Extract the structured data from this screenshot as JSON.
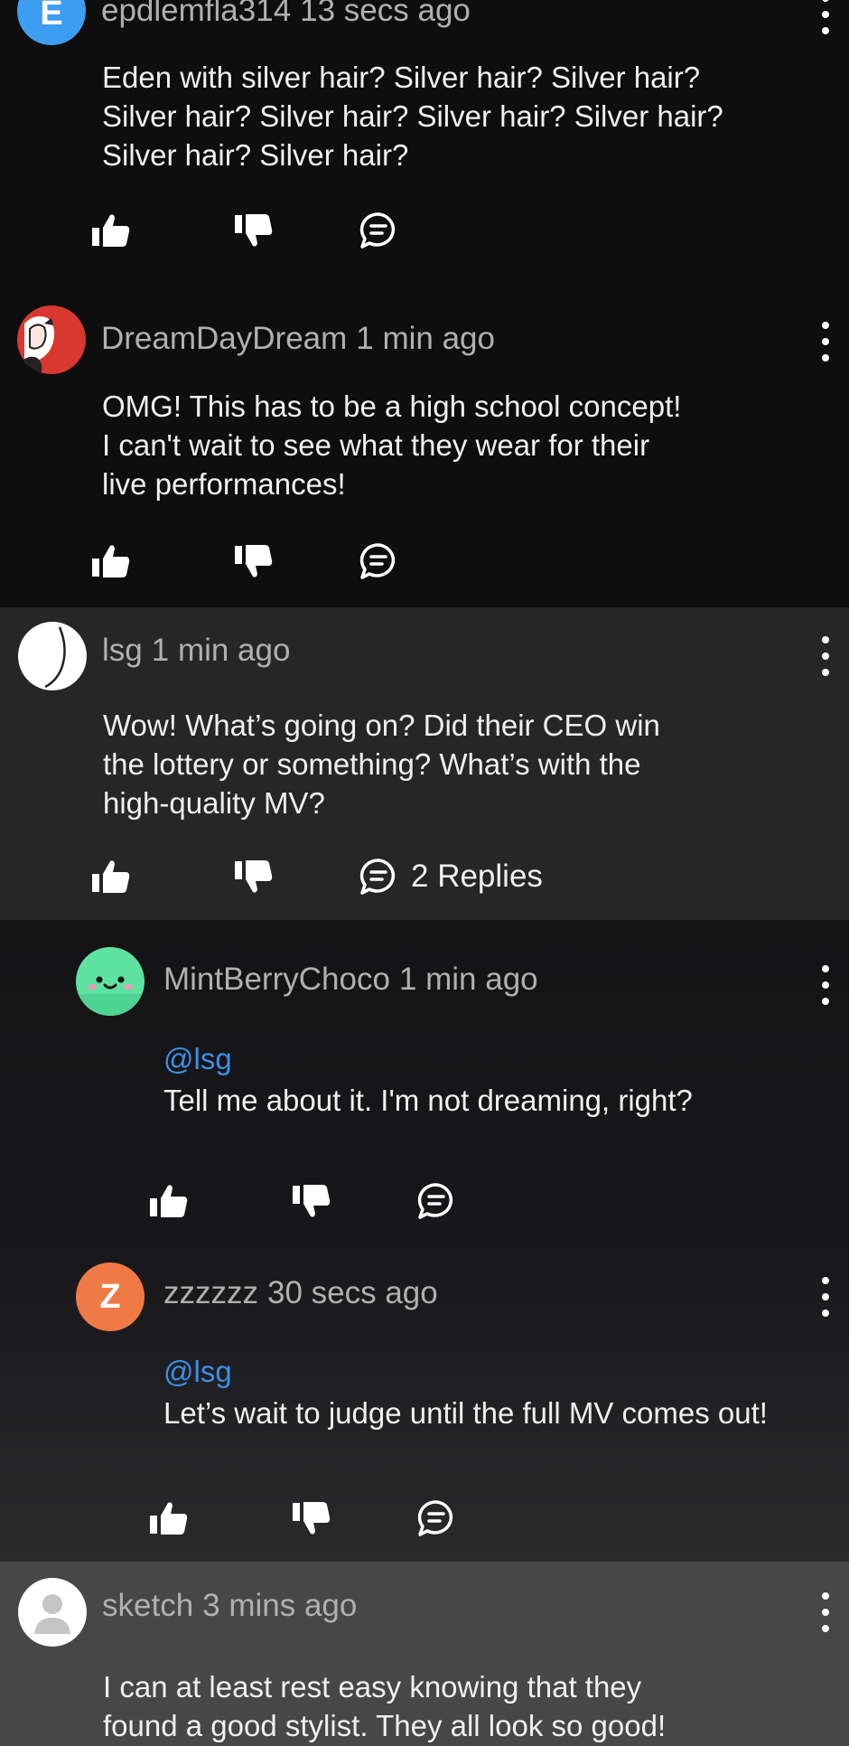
{
  "comments": [
    {
      "id": "c1",
      "username": "epdlemfla314",
      "time": "13 secs ago",
      "avatar_letter": "E",
      "avatar_color": "#3d9df0",
      "lines": [
        "Eden with silver hair? Silver hair? Silver hair?",
        "Silver hair? Silver hair? Silver hair? Silver hair?",
        "Silver hair? Silver hair?"
      ]
    },
    {
      "id": "c2",
      "username": "DreamDayDream",
      "time": "1 min ago",
      "avatar_color": "#d8382e",
      "lines": [
        "OMG! This has to be a high school concept!",
        "I can't wait to see what they wear for their",
        "live performances!"
      ]
    },
    {
      "id": "c3",
      "username": "lsg",
      "time": "1 min ago",
      "avatar_color": "#ffffff",
      "lines": [
        "Wow! What’s going on? Did their CEO win",
        "the lottery or something? What’s with the",
        "high-quality MV?"
      ],
      "replies_label": "2 Replies"
    },
    {
      "id": "r1",
      "username": "MintBerryChoco",
      "time": "1 min ago",
      "avatar_color": "#5ee2a0",
      "mention": "@lsg",
      "lines": [
        "Tell me about it. I'm not dreaming, right?"
      ]
    },
    {
      "id": "r2",
      "username": "zzzzzz",
      "time": "30 secs ago",
      "avatar_letter": "Z",
      "avatar_color": "#f07a45",
      "mention": "@lsg",
      "lines": [
        "Let’s wait to judge until the full MV comes out!"
      ]
    },
    {
      "id": "c4",
      "username": "sketch",
      "time": "3 mins ago",
      "avatar_color": "#ffffff",
      "lines": [
        "I can at least rest easy knowing that they",
        "found a good stylist. They all look so good!"
      ]
    }
  ],
  "icons": {
    "like": "thumbs-up-icon",
    "dislike": "thumbs-down-icon",
    "reply": "comment-bubble-icon",
    "more": "more-vertical-icon"
  },
  "colors": {
    "mention": "#3c8ee6",
    "username": "#b0b0b0",
    "text": "#f0f0f0"
  }
}
